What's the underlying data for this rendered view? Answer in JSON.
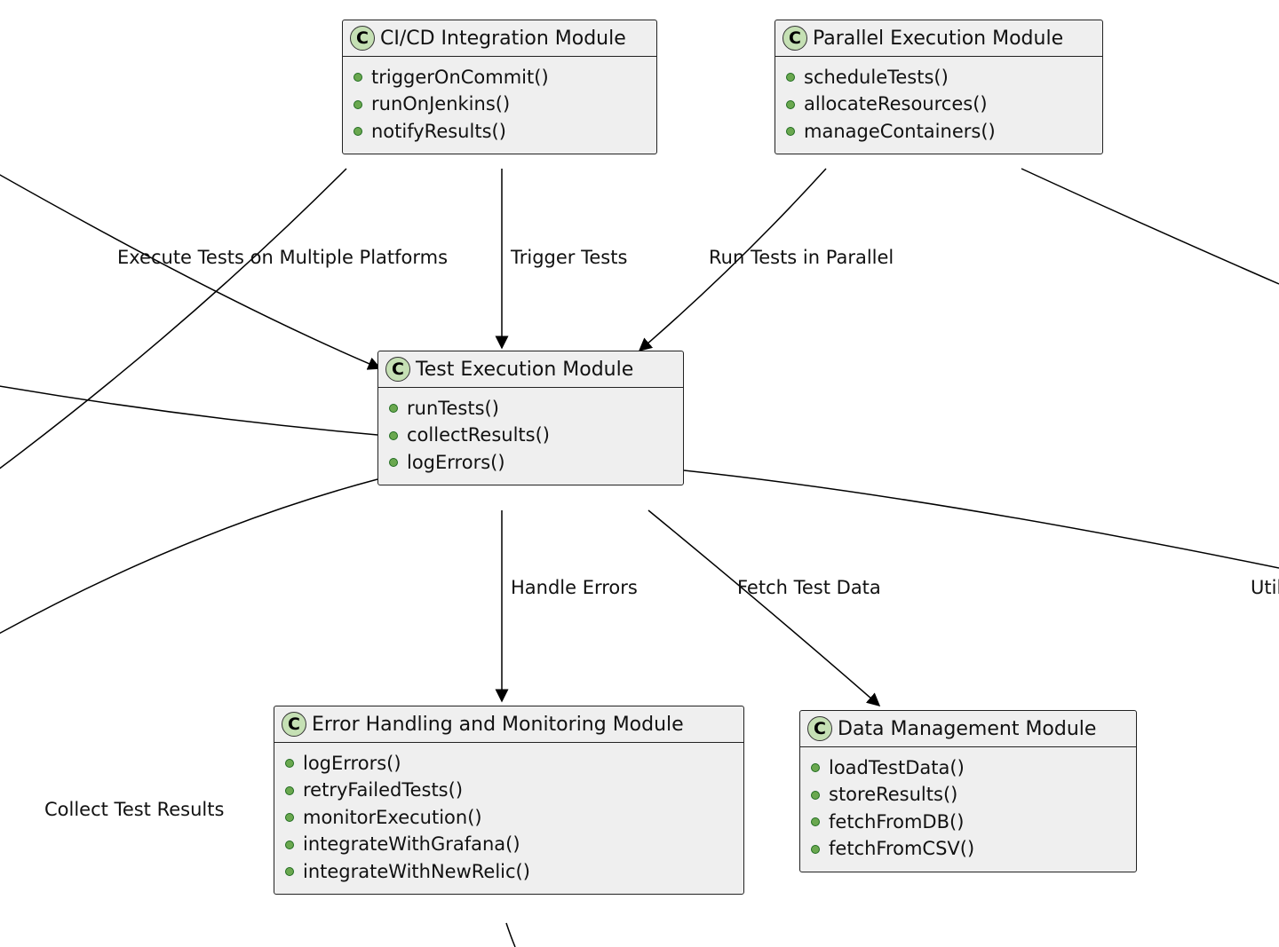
{
  "classes": {
    "cicd": {
      "title": "CI/CD Integration Module",
      "methods": [
        "triggerOnCommit()",
        "runOnJenkins()",
        "notifyResults()"
      ]
    },
    "parallel": {
      "title": "Parallel Execution Module",
      "methods": [
        "scheduleTests()",
        "allocateResources()",
        "manageContainers()"
      ]
    },
    "exec": {
      "title": "Test Execution Module",
      "methods": [
        "runTests()",
        "collectResults()",
        "logErrors()"
      ]
    },
    "error": {
      "title": "Error Handling and Monitoring Module",
      "methods": [
        "logErrors()",
        "retryFailedTests()",
        "monitorExecution()",
        "integrateWithGrafana()",
        "integrateWithNewRelic()"
      ]
    },
    "data": {
      "title": "Data Management Module",
      "methods": [
        "loadTestData()",
        "storeResults()",
        "fetchFromDB()",
        "fetchFromCSV()"
      ]
    }
  },
  "labels": {
    "trigger": "Trigger Tests",
    "parallel": "Run Tests in Parallel",
    "platforms": "Execute Tests on Multiple Platforms",
    "handle": "Handle Errors",
    "fetch": "Fetch Test Data",
    "util": "Util",
    "collect": "Collect Test Results"
  },
  "badge": "C"
}
